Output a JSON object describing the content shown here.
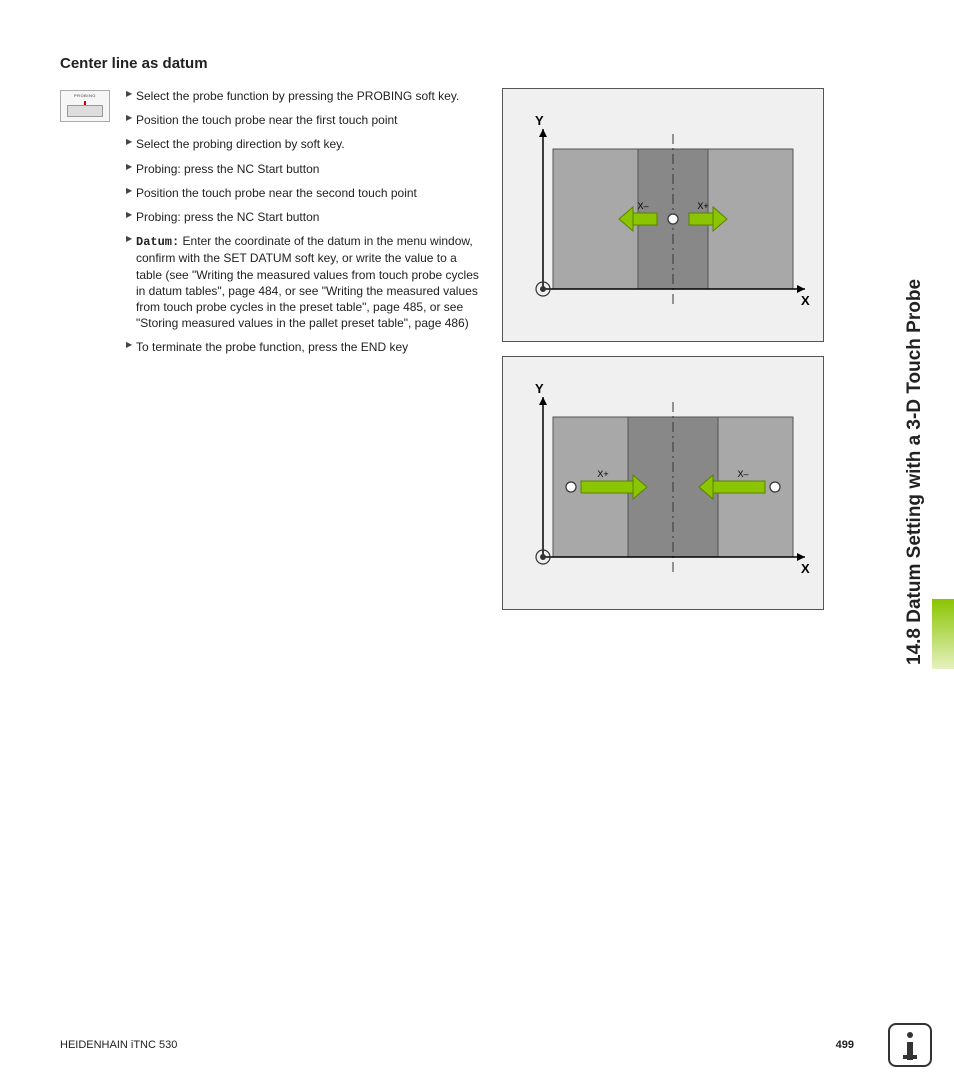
{
  "section": {
    "title": "Center line as datum",
    "side_label": "14.8 Datum Setting with a 3-D Touch Probe"
  },
  "icon": {
    "label": "PROBING"
  },
  "steps": {
    "s1": "Select the probe function by pressing the PROBING soft key.",
    "s2": "Position the touch probe near the first touch point",
    "s3": "Select the probing direction by soft key.",
    "s4": "Probing: press the NC Start button",
    "s5": "Position the touch probe near the second touch point",
    "s6": "Probing: press the NC Start button",
    "s7_label": "Datum:",
    "s7_text": " Enter the coordinate of the datum in the menu window, confirm with the SET DATUM soft key, or write the value to a table (see \"Writing the measured values from touch probe cycles in datum tables\", page 484, or see \"Writing the measured values from touch probe cycles in the preset table\", page 485, or see \"Storing measured values in the pallet preset table\", page 486)",
    "s8": "To terminate the probe function, press the END key"
  },
  "figures": {
    "fig1": {
      "xaxis": "X",
      "yaxis": "Y",
      "left_arrow": "X–",
      "right_arrow": "X+"
    },
    "fig2": {
      "xaxis": "X",
      "yaxis": "Y",
      "left_arrow": "X+",
      "right_arrow": "X–"
    }
  },
  "footer": {
    "product": "HEIDENHAIN iTNC 530",
    "page": "499"
  }
}
